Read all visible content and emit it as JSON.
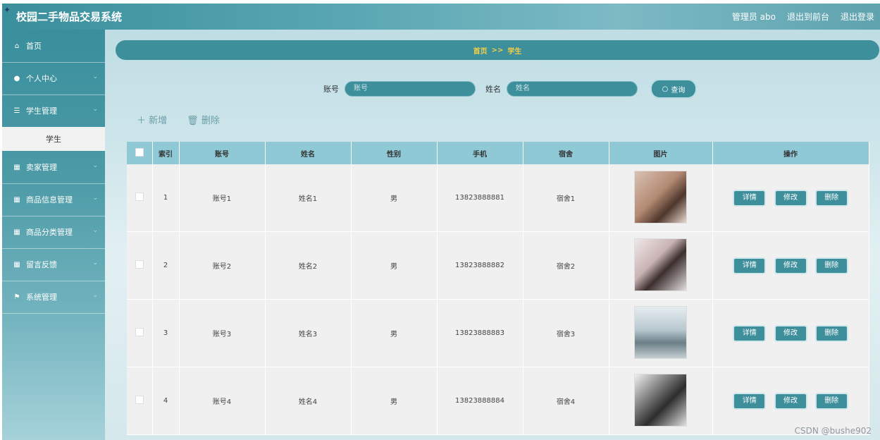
{
  "app": {
    "title": "校园二手物品交易系统",
    "admin_label": "管理员 abo",
    "exit_front_label": "退出到前台",
    "logout_label": "退出登录"
  },
  "sidebar": {
    "items": [
      {
        "label": "首页",
        "icon": "home-icon"
      },
      {
        "label": "个人中心",
        "icon": "user-icon"
      },
      {
        "label": "学生管理",
        "icon": "list-icon"
      },
      {
        "label": "卖家管理",
        "icon": "grid-icon"
      },
      {
        "label": "商品信息管理",
        "icon": "grid-icon"
      },
      {
        "label": "商品分类管理",
        "icon": "grid-icon"
      },
      {
        "label": "留言反馈",
        "icon": "grid-icon"
      },
      {
        "label": "系统管理",
        "icon": "flag-icon"
      }
    ],
    "sub_item": "学生"
  },
  "breadcrumb": {
    "home": "首页",
    "sep": ">>",
    "current": "学生"
  },
  "search": {
    "account_label": "账号",
    "account_placeholder": "账号",
    "name_label": "姓名",
    "name_placeholder": "姓名",
    "query_button": "查询"
  },
  "toolbar": {
    "add": "新增",
    "delete": "删除"
  },
  "table": {
    "headers": [
      "索引",
      "账号",
      "姓名",
      "性别",
      "手机",
      "宿舍",
      "图片",
      "操作"
    ],
    "rows": [
      {
        "index": "1",
        "account": "账号1",
        "name": "姓名1",
        "gender": "男",
        "phone": "13823888881",
        "dorm": "宿舍1"
      },
      {
        "index": "2",
        "account": "账号2",
        "name": "姓名2",
        "gender": "男",
        "phone": "13823888882",
        "dorm": "宿舍2"
      },
      {
        "index": "3",
        "account": "账号3",
        "name": "姓名3",
        "gender": "男",
        "phone": "13823888883",
        "dorm": "宿舍3"
      },
      {
        "index": "4",
        "account": "账号4",
        "name": "姓名4",
        "gender": "男",
        "phone": "13823888884",
        "dorm": "宿舍4"
      }
    ],
    "action_detail": "详情",
    "action_edit": "修改",
    "action_delete": "删除"
  },
  "watermark": "CSDN @bushe902",
  "colors": {
    "primary": "#3e8f9c",
    "header_row": "#8fc9d6",
    "breadcrumb_text": "#f5d047"
  }
}
